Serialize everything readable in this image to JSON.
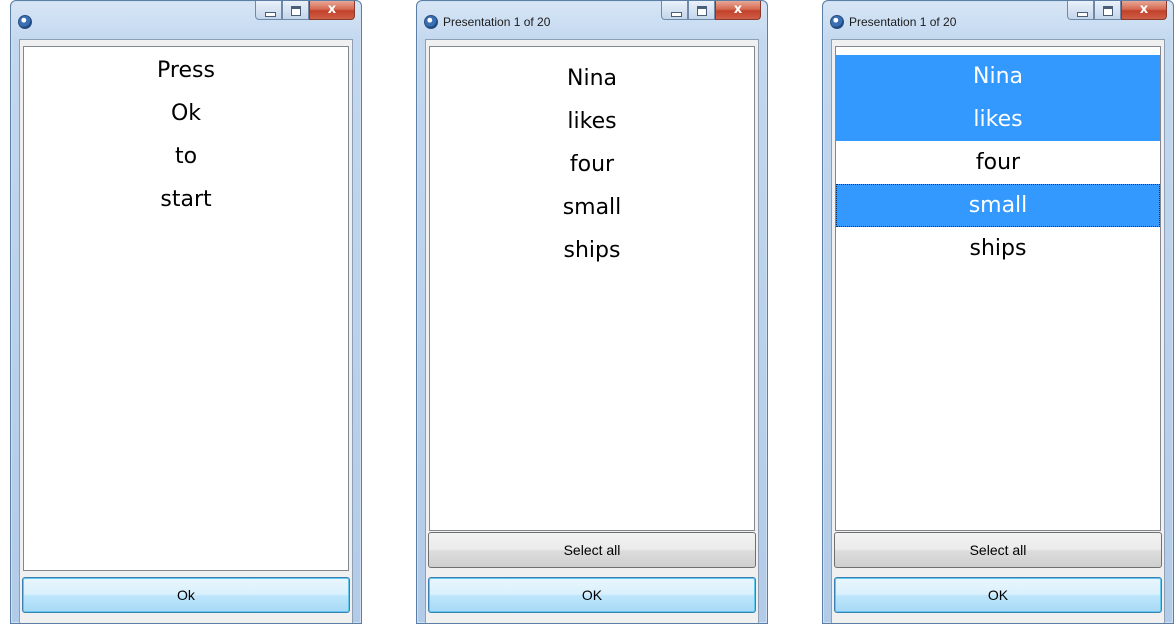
{
  "windows": [
    {
      "title": "",
      "words": [
        "Press",
        "Ok",
        "to",
        "start"
      ],
      "ok_label": "Ok"
    },
    {
      "title": "Presentation 1 of 20",
      "words": [
        "Nina",
        "likes",
        "four",
        "small",
        "ships"
      ],
      "select_all_label": "Select all",
      "ok_label": "OK"
    },
    {
      "title": "Presentation 1 of 20",
      "words": [
        "Nina",
        "likes",
        "four",
        "small",
        "ships"
      ],
      "selected_words": [
        "Nina",
        "likes",
        "small"
      ],
      "select_all_label": "Select all",
      "ok_label": "OK"
    }
  ],
  "caption_buttons": {
    "close": "x"
  },
  "colors": {
    "selection": "#3399ff",
    "default_button": "#bee6fd"
  }
}
